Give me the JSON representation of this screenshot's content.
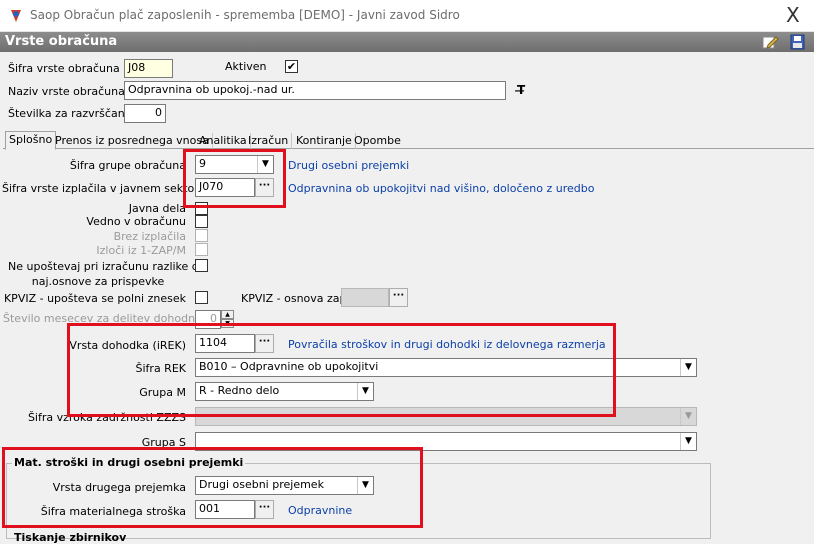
{
  "window": {
    "title": "Saop Obračun plač zaposlenih - sprememba [DEMO] - Javni zavod Sidro",
    "close_glyph": "X"
  },
  "header": {
    "title": "Vrste obračuna"
  },
  "top": {
    "sifra_label": "Šifra vrste obračuna",
    "sifra_value": "J08",
    "aktiven_label": "Aktiven",
    "aktiven_checked": true,
    "naziv_label": "Naziv vrste obračuna",
    "naziv_value": "Odpravnina ob upokoj.-nad ur.",
    "stevilka_label": "Številka  za razvrščanje",
    "stevilka_value": "0"
  },
  "tabs": [
    {
      "label": "Splošno"
    },
    {
      "label": "Prenos iz posrednega vnosa"
    },
    {
      "label": "Analitika"
    },
    {
      "label": "Izračun"
    },
    {
      "label": "Kontiranje"
    },
    {
      "label": "Opombe"
    }
  ],
  "general": {
    "skupina_label": "Šifra grupe obračuna",
    "skupina_value": "9",
    "skupina_desc": "Drugi osebni prejemki",
    "izplacilo_label": "Šifra vrste izplačila v javnem sektorju",
    "izplacilo_value": "J070",
    "izplacilo_desc": "Odpravnina ob upokojitvi nad višino, določeno z uredbo",
    "javna_dela_label": "Javna dela",
    "vedno_label": "Vedno v obračunu",
    "brez_label": "Brez izplačila",
    "izloci_label": "Izloči iz 1-ZAP/M",
    "neupostevaj_line1": "Ne upoštevaj pri izračunu razlike do",
    "neupostevaj_line2": "naj.osnove za prispevke",
    "kpviz_label": "KPVIZ - upošteva se polni znesek",
    "kpviz_osnova_label": "KPVIZ - osnova zap.",
    "mesecev_label": "Število mesecev za delitev dohodnine:",
    "mesecev_value": "0",
    "vrsta_dohodka_label": "Vrsta dohodka (iREK)",
    "vrsta_dohodka_value": "1104",
    "vrsta_dohodka_desc": "Povračila stroškov in drugi dohodki iz delovnega razmerja",
    "sifra_rek_label": "Šifra REK",
    "sifra_rek_value": "B010 – Odpravnine ob upokojitvi",
    "grupa_m_label": "Grupa M",
    "grupa_m_value": "R - Redno delo",
    "sifra_vzroka_label": "Šifra vzroka zadržnosti ZZZS",
    "grupa_s_label": "Grupa S",
    "grupa_s_value": ""
  },
  "mat": {
    "group_title": "Mat. stroški in drugi osebni prejemki",
    "vrsta_label": "Vrsta drugega prejemka",
    "vrsta_value": "Drugi osebni prejemek",
    "sifra_label": "Šifra materialnega stroška",
    "sifra_value": "001",
    "sifra_desc": "Odpravnine"
  },
  "bottom": {
    "group_title": "Tiskanje zbirnikov"
  },
  "icons": [
    "app-icon",
    "edit-icon",
    "save-icon",
    "text-format-icon",
    "ellipsis-icon",
    "dropdown-arrow-icon",
    "spin-up-icon",
    "spin-down-icon"
  ],
  "colors": {
    "highlight_box": "#e0101e",
    "link": "#0b3fa8",
    "header": "#7a7a7a"
  }
}
